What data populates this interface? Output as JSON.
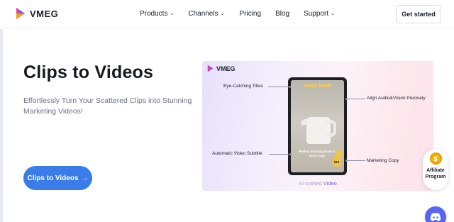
{
  "header": {
    "brand": "VMEG",
    "nav": [
      {
        "label": "Products",
        "dropdown": true
      },
      {
        "label": "Channels",
        "dropdown": true
      },
      {
        "label": "Pricing",
        "dropdown": false
      },
      {
        "label": "Blog",
        "dropdown": false
      },
      {
        "label": "Support",
        "dropdown": true
      }
    ],
    "cta": "Get started"
  },
  "hero": {
    "title": "Clips to Videos",
    "subtitle": "Effortlessly Turn Your Scattered Clips into Stunning Marketing Videos!",
    "button": "Clips to Videos",
    "button_icon": "→"
  },
  "showcase": {
    "brand": "VMEG",
    "screen_title": "Smart kettle",
    "screen_subtitle": "Perfect morning brew in every cup!",
    "screen_badge": "$19",
    "labels": {
      "eye_catching": "Eye-Catching Titles",
      "subtitle": "Automatic Video Subtitle",
      "align": "Align Audio&Vision Precisely",
      "marketing": "Marketing Copy"
    },
    "caption_prefix": "AI-crafted",
    "caption_highlight": "Video"
  },
  "floating": {
    "affiliate_line1": "Affiliate",
    "affiliate_line2": "Program",
    "coin_symbol": "$"
  },
  "colors": {
    "accent": "#3b7de8",
    "brand_purple": "#7c4dff",
    "discord": "#5865f2",
    "coin": "#f5b400"
  }
}
